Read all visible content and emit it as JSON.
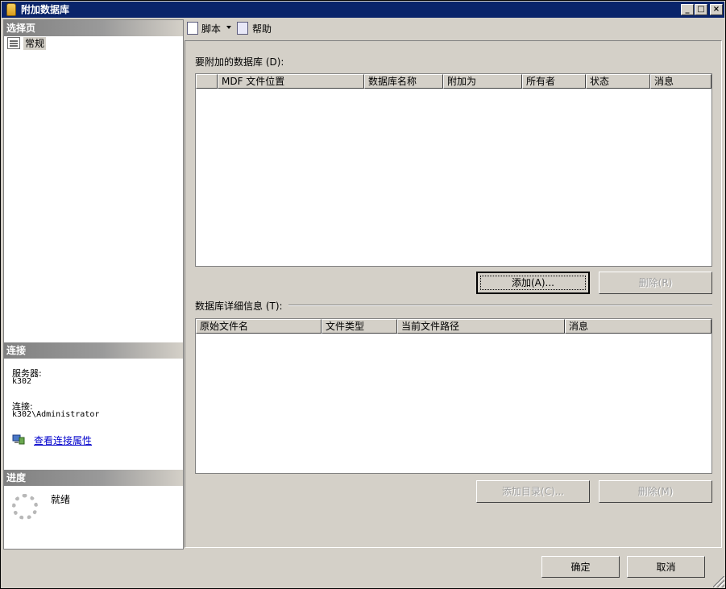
{
  "window": {
    "title": "附加数据库",
    "minimize_glyph": "_",
    "maximize_glyph": "□",
    "close_glyph": "×"
  },
  "left_pane": {
    "select_page_header": "选择页",
    "pages": [
      {
        "label": "常规",
        "icon": "general-page-icon"
      }
    ],
    "connection_header": "连接",
    "server_label": "服务器:",
    "server_value": "k302",
    "connection_label": "连接:",
    "connection_value": "k302\\Administrator",
    "view_connection_properties": "查看连接属性",
    "progress_header": "进度",
    "progress_status": "就绪"
  },
  "toolbar": {
    "script_label": "脚本",
    "script_dropdown_icon": "dropdown-arrow-icon",
    "help_label": "帮助"
  },
  "attach_section": {
    "label": "要附加的数据库 (D):",
    "columns": [
      "",
      "MDF 文件位置",
      "数据库名称",
      "附加为",
      "所有者",
      "状态",
      "消息"
    ],
    "rows": [],
    "add_button": "添加(A)...",
    "remove_button": "删除(R)"
  },
  "details_section": {
    "label": "数据库详细信息 (T):",
    "columns": [
      "原始文件名",
      "文件类型",
      "当前文件路径",
      "消息"
    ],
    "rows": [],
    "add_catalog_button": "添加目录(C)...",
    "remove_button": "删除(M)"
  },
  "footer": {
    "ok_button": "确定",
    "cancel_button": "取消"
  },
  "colors": {
    "titlebar": "#0a246a",
    "face": "#d4d0c8",
    "link": "#0000cc"
  }
}
